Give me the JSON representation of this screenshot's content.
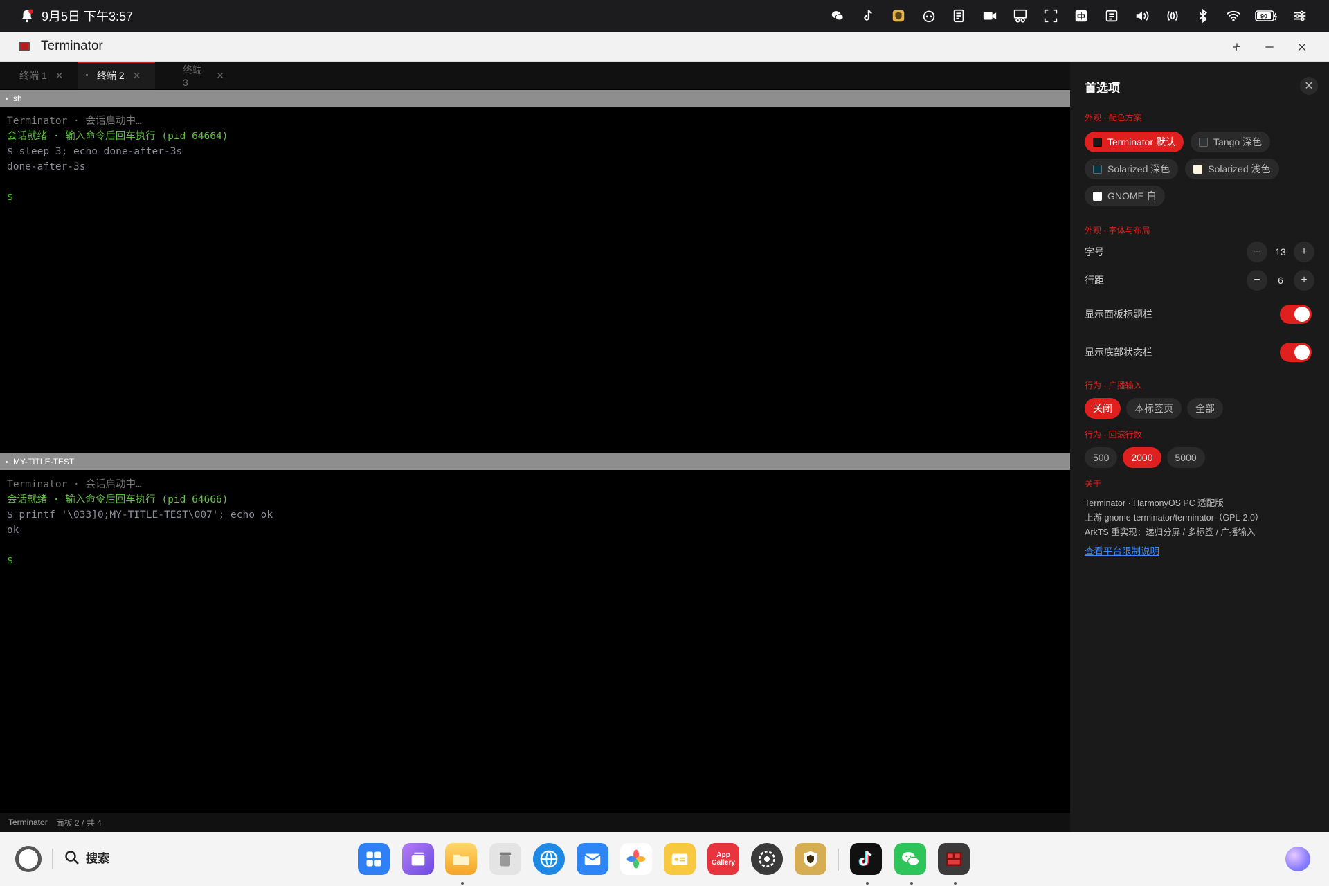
{
  "statusbar": {
    "datetime": "9月5日 下午3:57",
    "icons": [
      "wechat-icon",
      "tiktok-icon",
      "shield-app-icon",
      "ai-assistant-icon",
      "notes-icon",
      "screen-record-icon",
      "scissors-icon",
      "screenshot-icon",
      "input-method-icon",
      "clipboard-icon",
      "volume-icon",
      "nfc-icon",
      "bluetooth-icon",
      "wifi-icon",
      "battery-icon",
      "control-center-icon"
    ],
    "battery_level": "90"
  },
  "window": {
    "title": "Terminator",
    "controls": [
      "restore",
      "minimize",
      "close"
    ]
  },
  "tabs": [
    {
      "label": "终端 1",
      "active": false
    },
    {
      "label": "终端 2",
      "active": true
    },
    {
      "label": "终端 3",
      "active": false
    }
  ],
  "panes": [
    {
      "title": "sh",
      "lines": [
        {
          "text": "Terminator · 会话启动中…",
          "style": "grey"
        },
        {
          "text": "会话就绪 · 输入命令后回车执行 (pid 64664)",
          "style": "green"
        },
        {
          "text": "$ sleep 3; echo done-after-3s",
          "style": "cmd"
        },
        {
          "text": "done-after-3s",
          "style": "out"
        },
        {
          "text": "",
          "style": "out"
        },
        {
          "text": "$",
          "style": "prompt"
        }
      ]
    },
    {
      "title": "MY-TITLE-TEST",
      "lines": [
        {
          "text": "Terminator · 会话启动中…",
          "style": "grey"
        },
        {
          "text": "会话就绪 · 输入命令后回车执行 (pid 64666)",
          "style": "green"
        },
        {
          "text": "$ printf '\\033]0;MY-TITLE-TEST\\007'; echo ok",
          "style": "cmd"
        },
        {
          "text": "ok",
          "style": "out"
        },
        {
          "text": "",
          "style": "out"
        },
        {
          "text": "$",
          "style": "prompt"
        }
      ]
    }
  ],
  "statusline": {
    "app": "Terminator",
    "info": "面板 2 / 共 4"
  },
  "prefs": {
    "title": "首选项",
    "color_section": "外观 · 配色方案",
    "color_schemes": [
      {
        "label": "Terminator 默认",
        "selected": true,
        "swatch": "#1a1a1a"
      },
      {
        "label": "Tango 深色",
        "selected": false,
        "swatch": "#2e3436"
      },
      {
        "label": "Solarized 深色",
        "selected": false,
        "swatch": "#073642"
      },
      {
        "label": "Solarized 浅色",
        "selected": false,
        "swatch": "#fdf6e3"
      },
      {
        "label": "GNOME 白",
        "selected": false,
        "swatch": "#ffffff"
      }
    ],
    "font_section": "外观 · 字体与布局",
    "font_size_label": "字号",
    "font_size": "13",
    "line_spacing_label": "行距",
    "line_spacing": "6",
    "show_titlebar_label": "显示面板标题栏",
    "show_titlebar": true,
    "show_statusbar_label": "显示底部状态栏",
    "show_statusbar": true,
    "broadcast_section": "行为 · 广播输入",
    "broadcast_options": [
      {
        "label": "关闭",
        "selected": true
      },
      {
        "label": "本标签页",
        "selected": false
      },
      {
        "label": "全部",
        "selected": false
      }
    ],
    "scrollback_section": "行为 · 回滚行数",
    "scrollback_options": [
      {
        "label": "500",
        "selected": false
      },
      {
        "label": "2000",
        "selected": true
      },
      {
        "label": "5000",
        "selected": false
      }
    ],
    "about_section": "关于",
    "about_lines": [
      "Terminator · HarmonyOS PC 适配版",
      "上游 gnome-terminator/terminator（GPL-2.0）",
      "ArkTS 重实现：递归分屏 / 多标签 / 广播输入"
    ],
    "about_link": "查看平台限制说明"
  },
  "dock": {
    "search_label": "搜索",
    "apps": [
      {
        "name": "app-center-icon",
        "color": "#2f7ff5",
        "label": ""
      },
      {
        "name": "multitask-icon",
        "color": "#8a63f0",
        "label": ""
      },
      {
        "name": "files-icon",
        "color": "#f7b534",
        "label": ""
      },
      {
        "name": "trash-icon",
        "color": "#c9c9c9",
        "label": ""
      },
      {
        "name": "browser-icon",
        "color": "#1e88e5",
        "label": ""
      },
      {
        "name": "mail-icon",
        "color": "#2e86f6",
        "label": ""
      },
      {
        "name": "gallery-icon",
        "color": "#ffffff",
        "label": ""
      },
      {
        "name": "memo-icon",
        "color": "#f8c940",
        "label": ""
      },
      {
        "name": "appgallery-icon",
        "color": "#e8343c",
        "label": "App Gallery"
      },
      {
        "name": "settings-icon",
        "color": "#3a3a3a",
        "label": ""
      },
      {
        "name": "shield-icon",
        "color": "#d7ad53",
        "label": ""
      },
      {
        "name": "tiktok-icon",
        "color": "#111111",
        "label": ""
      },
      {
        "name": "wechat-icon",
        "color": "#2fc45a",
        "label": ""
      },
      {
        "name": "terminator-icon",
        "color": "#3b3b3b",
        "label": ""
      }
    ]
  }
}
